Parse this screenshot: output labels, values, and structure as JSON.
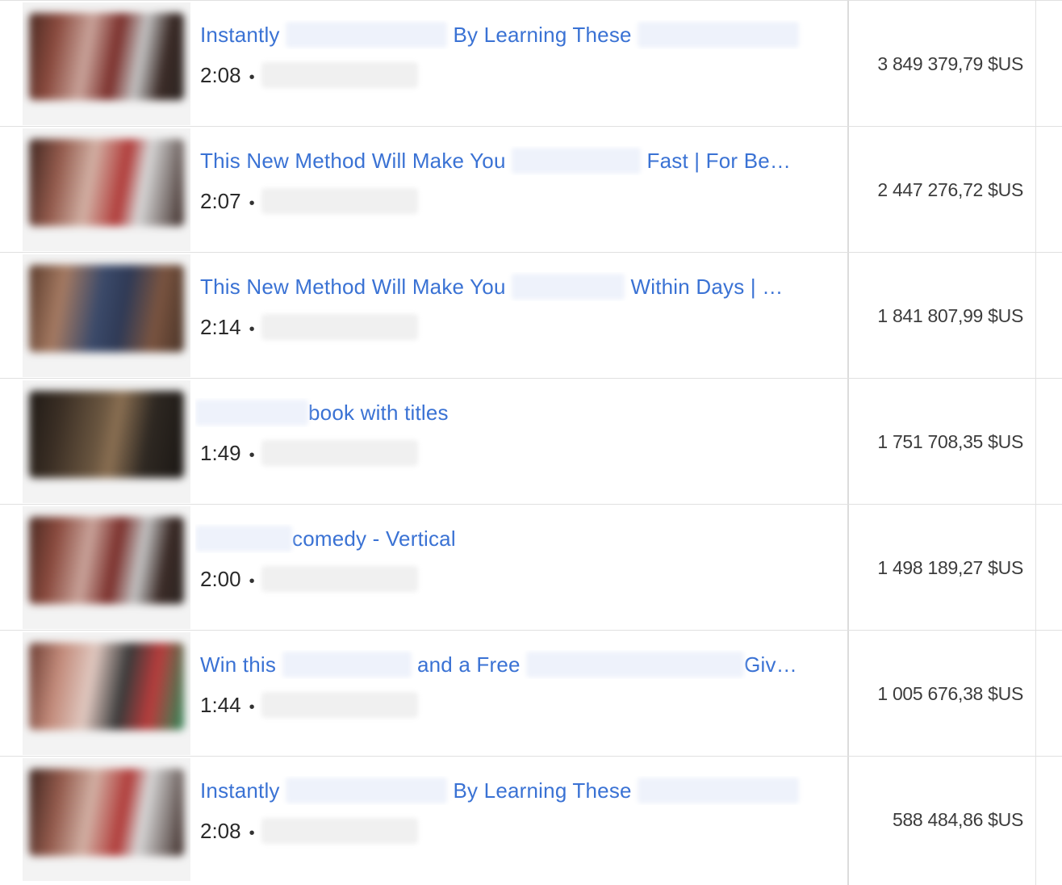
{
  "rows": [
    {
      "title_parts": [
        "Instantly",
        "By Learning These"
      ],
      "duration": "2:08",
      "separator": "•",
      "revenue": "3 849 379,79 $US",
      "thumbnail": "video-thumbnail"
    },
    {
      "title_parts": [
        "This New Method Will Make You",
        "Fast | For Be…"
      ],
      "duration": "2:07",
      "separator": "•",
      "revenue": "2 447 276,72 $US",
      "thumbnail": "video-thumbnail"
    },
    {
      "title_parts": [
        "This New Method Will Make You",
        "Within Days | …"
      ],
      "duration": "2:14",
      "separator": "•",
      "revenue": "1 841 807,99 $US",
      "thumbnail": "video-thumbnail"
    },
    {
      "title_parts": [
        "",
        "book with titles"
      ],
      "duration": "1:49",
      "separator": "•",
      "revenue": "1 751 708,35 $US",
      "thumbnail": "video-thumbnail"
    },
    {
      "title_parts": [
        "",
        "comedy - Vertical"
      ],
      "duration": "2:00",
      "separator": "•",
      "revenue": "1 498 189,27 $US",
      "thumbnail": "video-thumbnail"
    },
    {
      "title_parts": [
        "Win this",
        "and a Free",
        "Giv…"
      ],
      "duration": "1:44",
      "separator": "•",
      "revenue": "1 005 676,38 $US",
      "thumbnail": "video-thumbnail"
    },
    {
      "title_parts": [
        "Instantly",
        "By Learning These"
      ],
      "duration": "2:08",
      "separator": "•",
      "revenue": "588 484,86 $US",
      "thumbnail": "video-thumbnail"
    }
  ],
  "colors": {
    "link": "#3a72d4",
    "text": "#2a2a2a",
    "divider": "#e0e0e0"
  }
}
